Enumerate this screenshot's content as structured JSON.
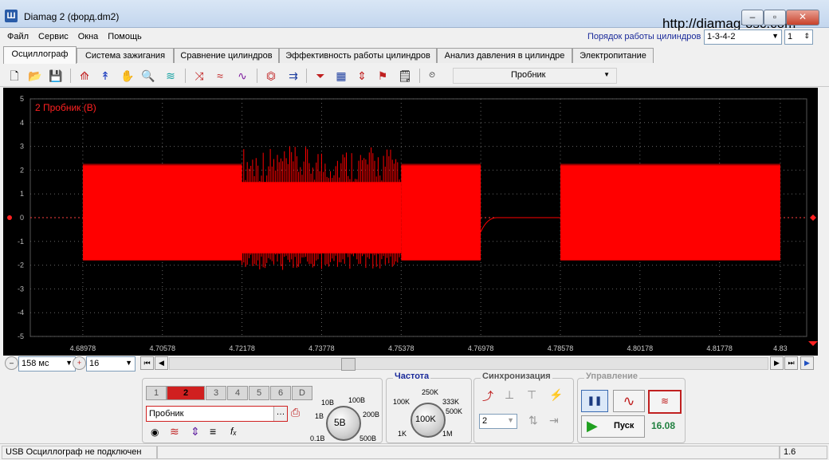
{
  "window": {
    "title": "Diamag 2 (форд.dm2)",
    "app_icon": "Ш",
    "url": "http://diamag-osc.com",
    "min": "–",
    "max": "▫",
    "close": "✕"
  },
  "menu": [
    "Файл",
    "Сервис",
    "Окна",
    "Помощь"
  ],
  "cylinder_order": {
    "label": "Порядок работы цилиндров",
    "value": "1-3-4-2",
    "cyl": "1"
  },
  "tabs": [
    "Осциллограф",
    "Система зажигания",
    "Сравнение цилиндров",
    "Эффективность работы цилиндров",
    "Анализ давления в цилиндре",
    "Электропитание"
  ],
  "toolbar": {
    "icons": [
      "new-file-icon",
      "open-folder-icon",
      "save-icon",
      "cursor-a-icon",
      "cursor-b-icon",
      "hand-icon",
      "zoom-icon",
      "scope-icon",
      "signal-invert-icon",
      "wave-overlay-icon",
      "wave-add-icon",
      "measure-auto-icon",
      "measure-zero-icon",
      "filter-icon",
      "table-icon",
      "split-icon",
      "flag-icon",
      "notes-icon",
      "auto-icon"
    ],
    "probe": "Пробник"
  },
  "scope": {
    "channel_label": "2 Пробник (В)",
    "y_ticks": [
      "5",
      "4",
      "3",
      "2",
      "1",
      "0",
      "-1",
      "-2",
      "-3",
      "-4",
      "-5"
    ],
    "x_ticks": [
      "4.68978",
      "4.70578",
      "4.72178",
      "4.73778",
      "4.75378",
      "4.76978",
      "4.78578",
      "4.80178",
      "4.81778",
      "4.83"
    ],
    "trace_color": "#ff0000",
    "segments": [
      {
        "type": "steady",
        "x_start": 4.68978,
        "x_end": 4.72178,
        "y_max": 2.2,
        "y_min": -1.8
      },
      {
        "type": "burst",
        "x_start": 4.72178,
        "x_end": 4.75378,
        "y_max": 3.0,
        "y_min": -2.2
      },
      {
        "type": "steady",
        "x_start": 4.75378,
        "x_end": 4.76978,
        "y_max": 2.2,
        "y_min": -1.8
      },
      {
        "type": "zero",
        "x_start": 4.76978,
        "x_end": 4.78578,
        "y_max": 0,
        "y_min": 0
      },
      {
        "type": "steady",
        "x_start": 4.78578,
        "x_end": 4.83,
        "y_max": 2.2,
        "y_min": -1.8
      }
    ]
  },
  "timebase": {
    "value": "158 мс",
    "zoom": "16"
  },
  "channels": {
    "buttons": [
      "1",
      "2",
      "3",
      "4",
      "5",
      "6",
      "D"
    ],
    "active": "2",
    "probe": "Пробник",
    "knob_value": "5В",
    "ticks": [
      "10В",
      "100В",
      "1В",
      "200В",
      "0.1В",
      "500В"
    ]
  },
  "frequency": {
    "title": "Частота",
    "knob_value": "100K",
    "ticks": [
      "250K",
      "100K",
      "333K",
      "500K",
      "1K",
      "1M"
    ]
  },
  "sync": {
    "title": "Синхронизация",
    "channel": "2"
  },
  "control": {
    "title": "Управление",
    "start": "Пуск",
    "fps": "16.08"
  },
  "status": {
    "text": "USB Осциллограф не подключен",
    "version": "1.6"
  }
}
